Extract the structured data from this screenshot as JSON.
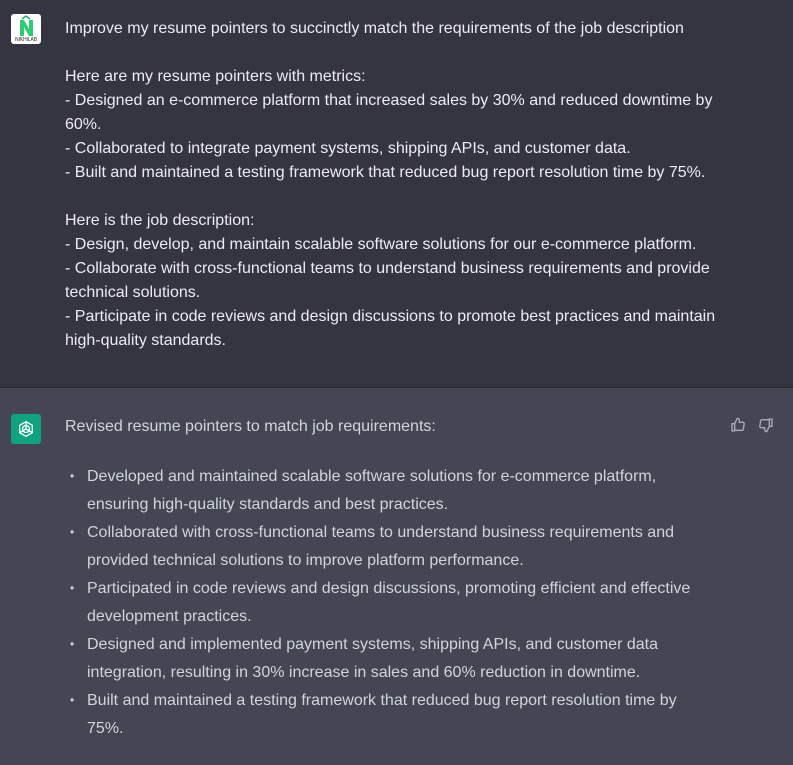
{
  "user_message": {
    "avatar_caption": "NIKHILAB",
    "lines": [
      "Improve my resume pointers to succinctly match the requirements of the job description",
      "",
      "Here are my resume pointers with metrics:",
      "- Designed an e-commerce platform that increased sales by 30% and reduced downtime by",
      "60%.",
      "- Collaborated to integrate payment systems, shipping APIs, and customer data.",
      "- Built and maintained a testing framework that reduced bug report resolution time by 75%.",
      "",
      "Here is the job description:",
      "- Design, develop, and maintain scalable software solutions for our e-commerce platform.",
      "- Collaborate with cross-functional teams to understand business requirements and provide",
      "technical solutions.",
      "- Participate in code reviews and design discussions to promote best practices and maintain",
      "high-quality standards."
    ]
  },
  "assistant_message": {
    "intro": "Revised resume pointers to match job requirements:",
    "bullets": [
      "Developed and maintained scalable software solutions for e-commerce platform, ensuring high-quality standards and best practices.",
      "Collaborated with cross-functional teams to understand business requirements and provided technical solutions to improve platform performance.",
      "Participated in code reviews and design discussions, promoting efficient and effective development practices.",
      "Designed and implemented payment systems, shipping APIs, and customer data integration, resulting in 30% increase in sales and 60% reduction in downtime.",
      "Built and maintained a testing framework that reduced bug report resolution time by 75%."
    ],
    "bullet_glyph": "•"
  },
  "icons": {
    "user_avatar": "user-avatar-logo-icon",
    "assistant_avatar": "openai-logo-icon",
    "thumbs_up": "thumbs-up-icon",
    "thumbs_down": "thumbs-down-icon"
  },
  "colors": {
    "user_bg": "#343541",
    "assistant_bg": "#444654",
    "bot_avatar_bg": "#10a37f",
    "user_avatar_accent": "#2ecc71"
  }
}
